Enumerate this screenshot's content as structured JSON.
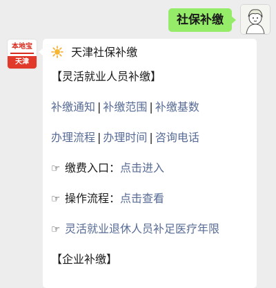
{
  "outgoing_message": {
    "text": "社保补缴"
  },
  "bot": {
    "logo_top": "本地宝",
    "logo_bottom": "天津"
  },
  "incoming_message": {
    "title": "天津社保补缴",
    "section1_heading": "【灵活就业人员补缴】",
    "row1_links": [
      "补缴通知",
      "补缴范围",
      "补缴基数"
    ],
    "row2_links": [
      "办理流程",
      "办理时间",
      "咨询电话"
    ],
    "separator": "|",
    "hand_glyph": "☞",
    "payment_label": "缴费入口：",
    "payment_link": "点击进入",
    "process_label": "操作流程：",
    "process_link": "点击查看",
    "retiree_link": "灵活就业退休人员补足医疗年限",
    "section2_heading": "【企业补缴】"
  },
  "colors": {
    "link": "#576b95",
    "outgoing_bubble": "#95ec69",
    "background": "#ededed"
  },
  "icons": {
    "sun": "sun-icon",
    "pointing_hand": "pointing-hand-icon"
  }
}
